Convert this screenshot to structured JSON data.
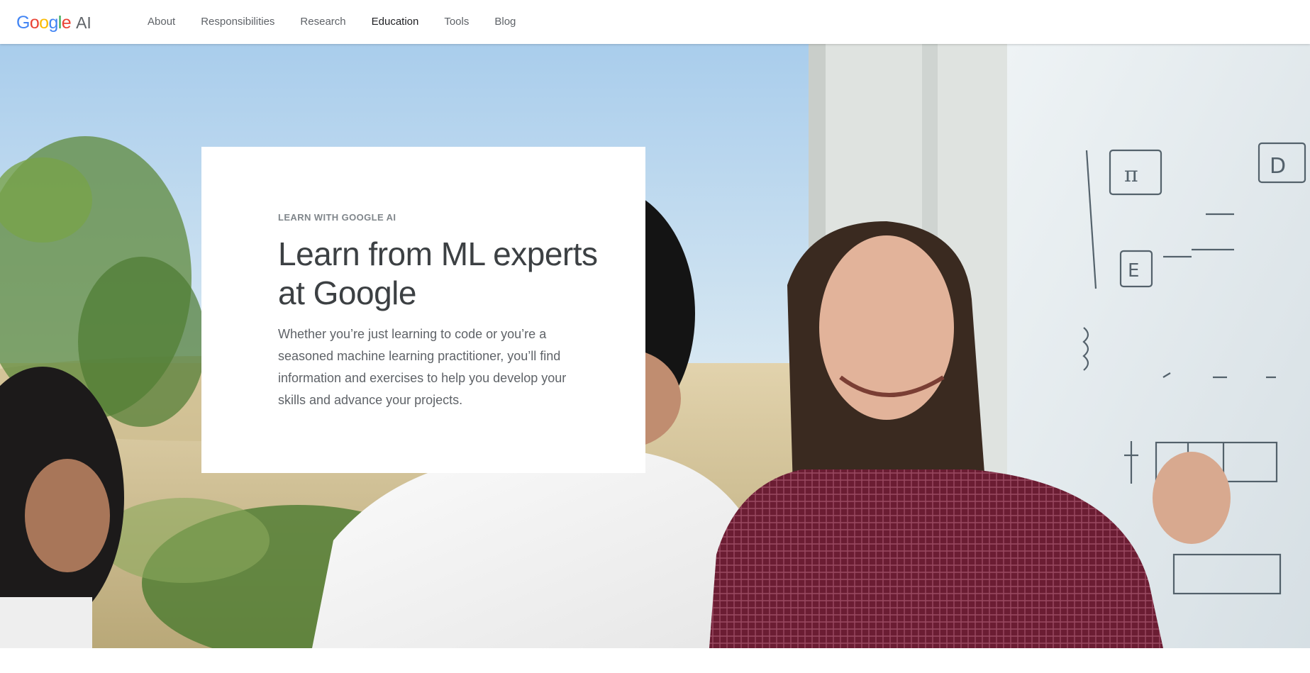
{
  "header": {
    "logo": {
      "brand_letters": [
        "G",
        "o",
        "o",
        "g",
        "l",
        "e"
      ],
      "brand_colors": [
        "#4285F4",
        "#EA4335",
        "#FBBC05",
        "#4285F4",
        "#34A853",
        "#EA4335"
      ],
      "suffix": "AI"
    },
    "nav": [
      {
        "label": "About",
        "active": false
      },
      {
        "label": "Responsibilities",
        "active": false
      },
      {
        "label": "Research",
        "active": false
      },
      {
        "label": "Education",
        "active": true
      },
      {
        "label": "Tools",
        "active": false
      },
      {
        "label": "Blog",
        "active": false
      }
    ]
  },
  "hero": {
    "eyebrow": "LEARN WITH GOOGLE AI",
    "headline": "Learn from ML experts at Google",
    "body": "Whether you’re just learning to code or you’re a seasoned machine learning practitioner, you’ll find information and exercises to help you develop your skills and advance your projects."
  },
  "colors": {
    "text_primary": "#3c4043",
    "text_secondary": "#5f6368",
    "nav_active": "#202124",
    "eyebrow": "#80868b"
  }
}
